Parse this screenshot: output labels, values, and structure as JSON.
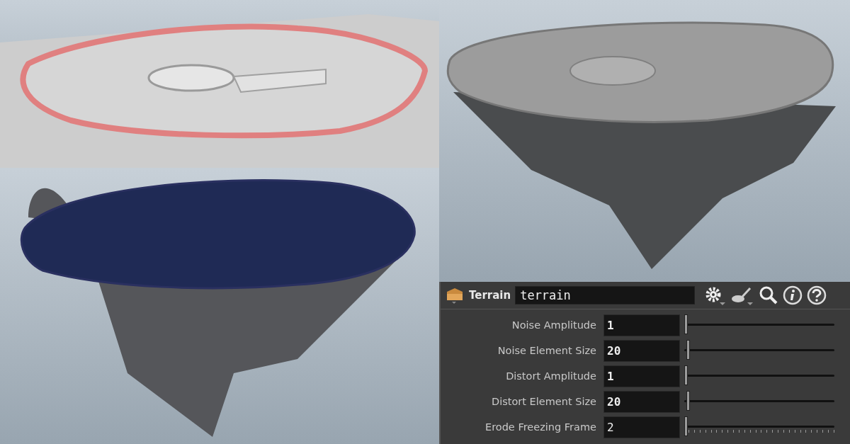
{
  "viewports": [
    {
      "kind": "heightfield"
    },
    {
      "kind": "island_blue"
    },
    {
      "kind": "island_grey"
    }
  ],
  "panel": {
    "node_type": "Terrain",
    "node_name": "terrain",
    "params": [
      {
        "label": "Noise Amplitude",
        "value": "1",
        "changed": true,
        "level": 0.0,
        "kind": "plain"
      },
      {
        "label": "Noise Element Size",
        "value": "20",
        "changed": true,
        "level": 0.015,
        "kind": "plain"
      },
      {
        "label": "Distort Amplitude",
        "value": "1",
        "changed": true,
        "level": 0.0,
        "kind": "plain"
      },
      {
        "label": "Distort Element Size",
        "value": "20",
        "changed": true,
        "level": 0.015,
        "kind": "plain"
      },
      {
        "label": "Erode Freezing Frame",
        "value": "2",
        "changed": false,
        "level": 0.0,
        "kind": "ticked"
      }
    ]
  }
}
